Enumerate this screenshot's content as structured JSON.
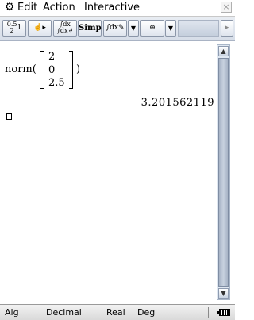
{
  "menu": {
    "gear_icon": "gear-icon",
    "items": [
      "Edit",
      "Action",
      "Interactive"
    ],
    "close_glyph": "×"
  },
  "toolbar": {
    "frac_top": "0.5",
    "frac_mid": "1",
    "frac_bottom": "2",
    "hand_glyph": "☝▸",
    "dx_top": "∫dx",
    "dx_bottom": "∫dx↵",
    "simp_label": "Simp",
    "dxp_label": "∫dx✎",
    "dropdown_glyph": "▼",
    "graph_glyph": "⊕",
    "next_glyph": "▸"
  },
  "work": {
    "function_name": "norm(",
    "matrix": [
      "2",
      "0",
      "2.5"
    ],
    "close_paren": ")",
    "result": "3.201562119"
  },
  "scrollbar": {
    "up_glyph": "▲",
    "down_glyph": "▼"
  },
  "status": {
    "mode": "Alg",
    "format": "Decimal",
    "domain": "Real",
    "angle": "Deg"
  }
}
